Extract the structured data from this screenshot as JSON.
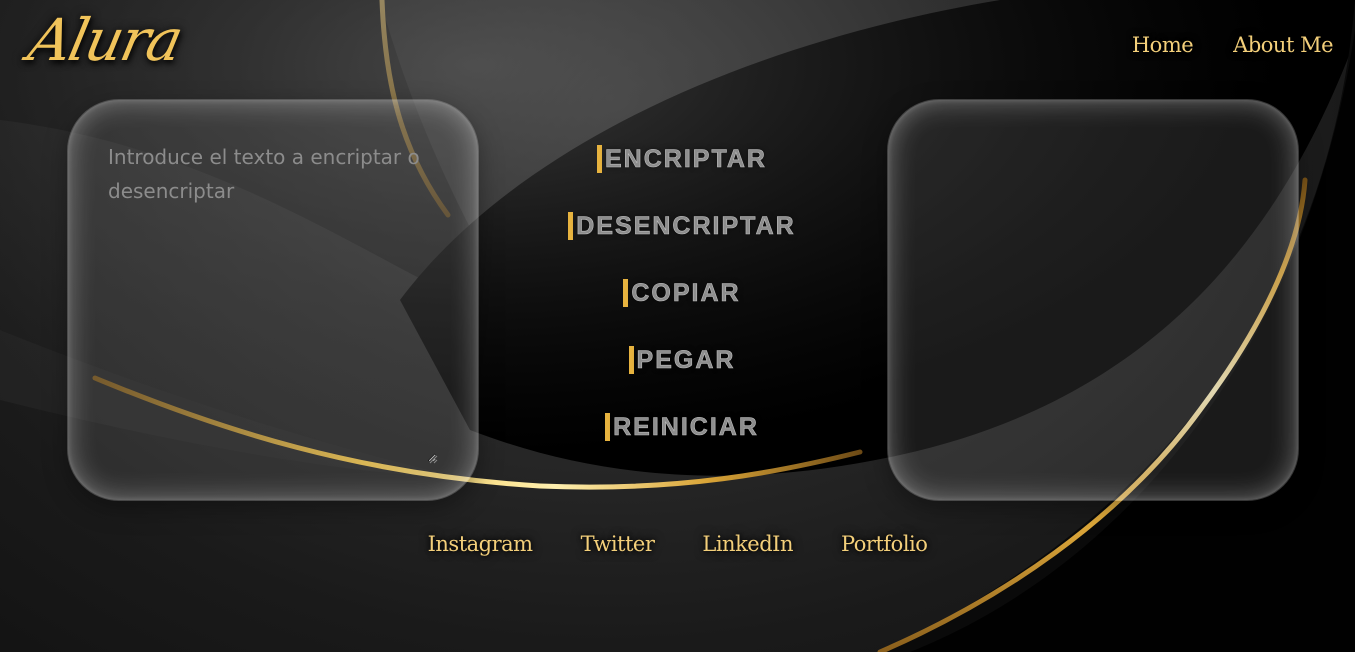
{
  "brand": {
    "logo_text": "Alura"
  },
  "nav": {
    "items": [
      {
        "label": "Home"
      },
      {
        "label": "About Me"
      }
    ]
  },
  "input_panel": {
    "placeholder": "Introduce el texto a encriptar o desencriptar",
    "value": ""
  },
  "output_panel": {
    "value": ""
  },
  "actions": [
    {
      "label": "ENCRIPTAR"
    },
    {
      "label": "DESENCRIPTAR"
    },
    {
      "label": "COPIAR"
    },
    {
      "label": "PEGAR"
    },
    {
      "label": "REINICIAR"
    }
  ],
  "social": [
    {
      "label": "Instagram"
    },
    {
      "label": "Twitter"
    },
    {
      "label": "LinkedIn"
    },
    {
      "label": "Portfolio"
    }
  ],
  "colors": {
    "accent_gold": "#e7b33f",
    "link_gold": "#f3cf7a",
    "button_text": "#8d8d8d",
    "background_dark": "#141414"
  }
}
